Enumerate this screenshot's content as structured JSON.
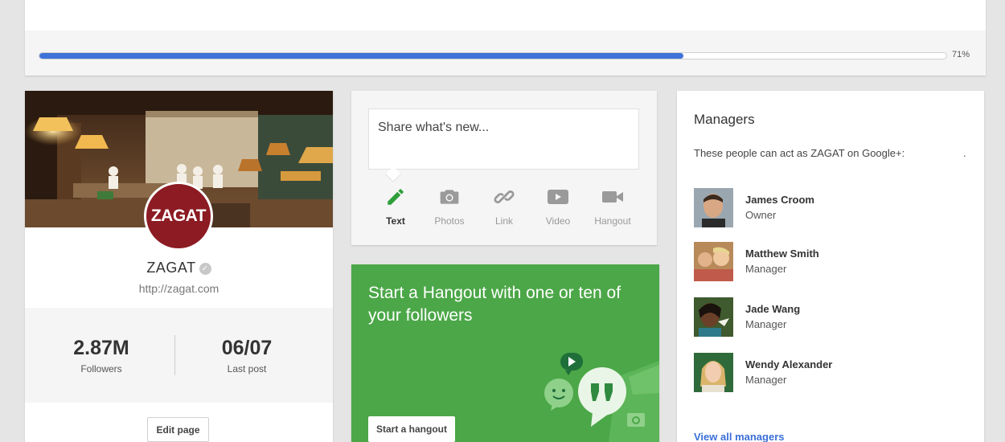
{
  "progress": {
    "value": 0.71,
    "label": "71%",
    "color": "#3f73d9"
  },
  "profile": {
    "logo_text": "ZAGAT",
    "name": "ZAGAT",
    "verified_icon": "check-shield-icon",
    "url": "http://zagat.com",
    "stats": [
      {
        "value": "2.87M",
        "label": "Followers"
      },
      {
        "value": "06/07",
        "label": "Last post"
      }
    ],
    "edit_button": "Edit page",
    "brand_color": "#8c1b23"
  },
  "share": {
    "placeholder": "Share what's new...",
    "options": [
      {
        "label": "Text",
        "icon": "pencil-icon",
        "active": true
      },
      {
        "label": "Photos",
        "icon": "camera-icon",
        "active": false
      },
      {
        "label": "Link",
        "icon": "link-icon",
        "active": false
      },
      {
        "label": "Video",
        "icon": "play-icon",
        "active": false
      },
      {
        "label": "Hangout",
        "icon": "video-camera-icon",
        "active": false
      }
    ]
  },
  "hangout": {
    "title": "Start a Hangout with one or ten of your followers",
    "button": "Start a hangout",
    "color": "#4ba747"
  },
  "managers": {
    "title": "Managers",
    "description": "These people can act as ZAGAT on Google+:",
    "trailing": ".",
    "people": [
      {
        "name": "James Croom",
        "role": "Owner"
      },
      {
        "name": "Matthew Smith",
        "role": "Manager"
      },
      {
        "name": "Jade Wang",
        "role": "Manager"
      },
      {
        "name": "Wendy Alexander",
        "role": "Manager"
      }
    ],
    "view_all": "View all managers",
    "link_color": "#3b6fd8"
  }
}
